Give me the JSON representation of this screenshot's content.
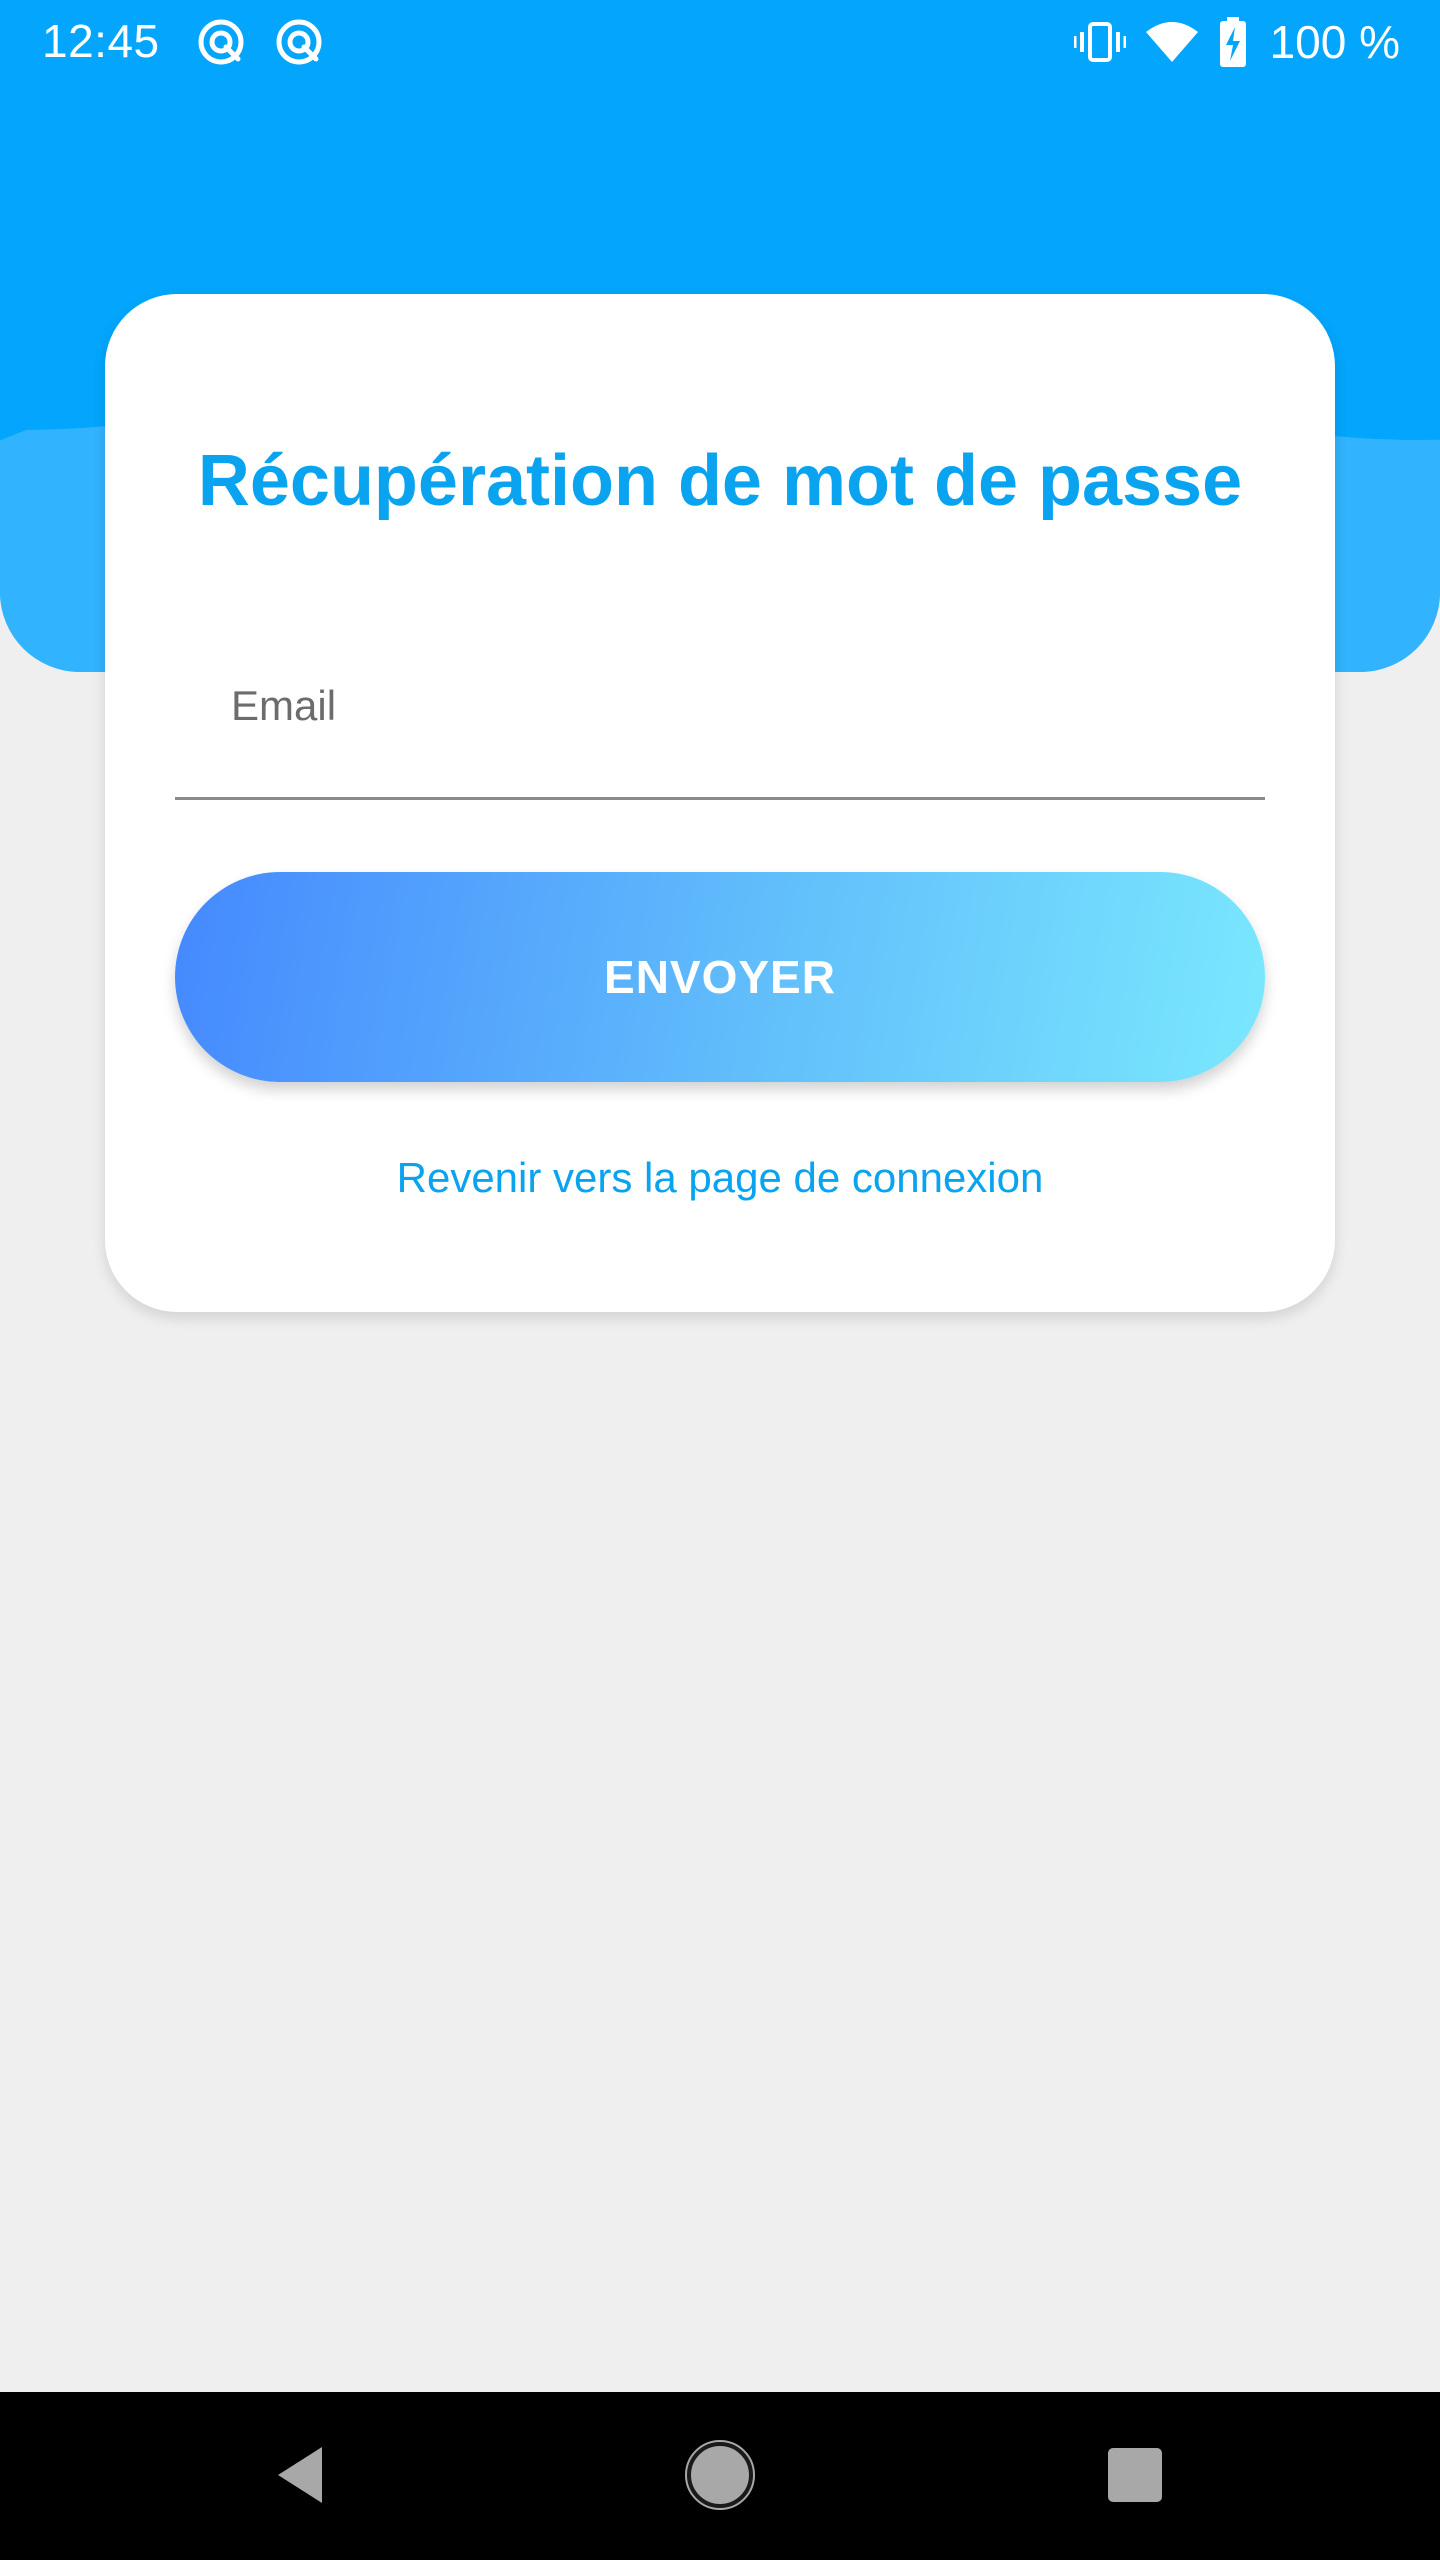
{
  "status_bar": {
    "time": "12:45",
    "battery": "100 %",
    "left_icons": [
      "sync-icon",
      "sync-icon"
    ],
    "right_icons": [
      "vibrate-icon",
      "wifi-icon",
      "battery-charging-icon"
    ]
  },
  "colors": {
    "header_blue": "#03a6fc",
    "accent": "#0aa3f0",
    "button_gradient_start": "#4589fe",
    "button_gradient_end": "#7ae8fe",
    "page_background": "#efefef"
  },
  "form": {
    "title": "Récupération de mot de passe",
    "email_placeholder": "Email",
    "email_value": "",
    "submit_label": "ENVOYER",
    "back_link": "Revenir vers la page de connexion"
  },
  "nav_bar": {
    "buttons": [
      "back-icon",
      "home-icon",
      "recents-icon"
    ]
  }
}
